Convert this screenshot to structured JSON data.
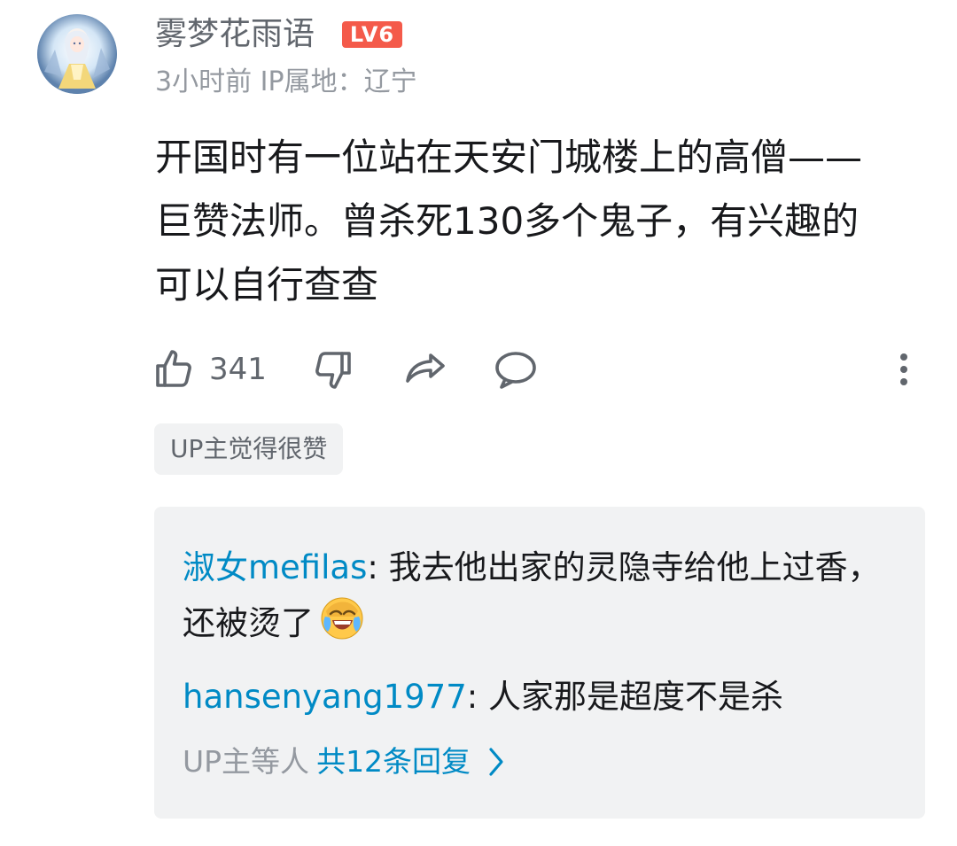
{
  "comment": {
    "author": "雾梦花雨语",
    "level_badge": "LV6",
    "time": "3小时前",
    "ip_location": "IP属地：辽宁",
    "text": "开国时有一位站在天安门城楼上的高僧——\n巨赞法师。曾杀死130多个鬼子，有兴趣的\n可以自行查查",
    "like_count": "341",
    "up_tag": "UP主觉得很赞",
    "icons": {
      "avatar": "anime-girl-avatar",
      "like": "thumbs-up-icon",
      "dislike": "thumbs-down-icon",
      "share": "share-icon",
      "reply": "comment-bubble-icon",
      "more": "more-vertical-icon"
    }
  },
  "replies": {
    "items": [
      {
        "author": "淑女mefilas",
        "separator": ": ",
        "text": "我去他出家的灵隐寺给他上过香，还被烫了",
        "emoji": "laughing-tears-emoji"
      },
      {
        "author": "hansenyang1977",
        "separator": ": ",
        "text": "人家那是超度不是杀"
      }
    ],
    "summary_prefix": "UP主等人",
    "summary_link": "共12条回复",
    "chevron": "chevron-right-icon"
  },
  "colors": {
    "link_blue": "#008ac5",
    "level_red": "#f45a4a",
    "muted_gray": "#9499a0",
    "panel_bg": "#f1f2f3"
  }
}
